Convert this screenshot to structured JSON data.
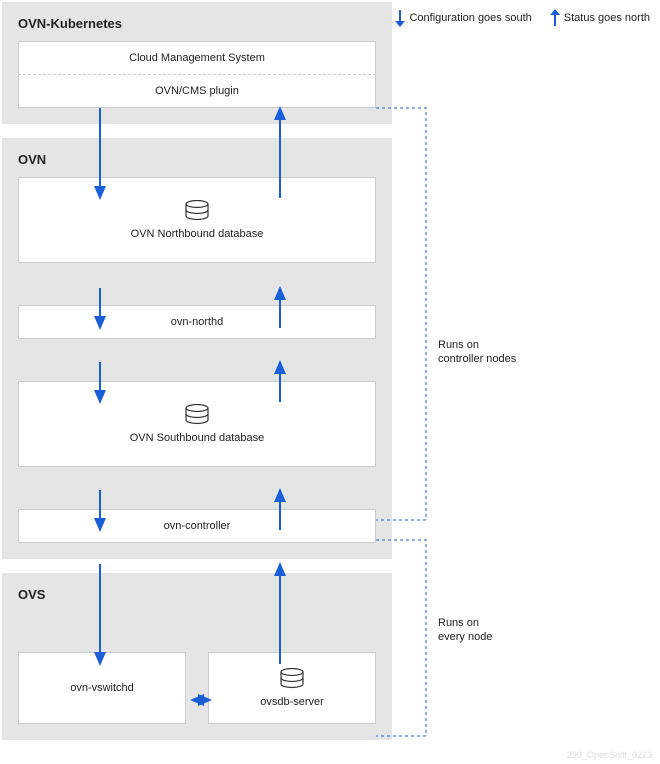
{
  "legend": {
    "down": "Configuration goes south",
    "up": "Status goes north"
  },
  "sections": {
    "ovn_kubernetes": {
      "title": "OVN-Kubernetes",
      "cms": "Cloud Management System",
      "plugin": "OVN/CMS plugin"
    },
    "ovn": {
      "title": "OVN",
      "northbound": "OVN Northbound database",
      "northd": "ovn-northd",
      "southbound": "OVN Southbound database",
      "controller": "ovn-controller"
    },
    "ovs": {
      "title": "OVS",
      "vswitchd": "ovn-vswitchd",
      "ovsdb": "ovsdb-server"
    }
  },
  "notes": {
    "controller_nodes": "Runs on\ncontroller nodes",
    "every_node": "Runs on\nevery node"
  },
  "footer": "299_OpenShift_0223",
  "colors": {
    "arrow": "#1a5fd8",
    "dashed": "#1a5fd8",
    "section_bg": "#e5e5e5"
  }
}
